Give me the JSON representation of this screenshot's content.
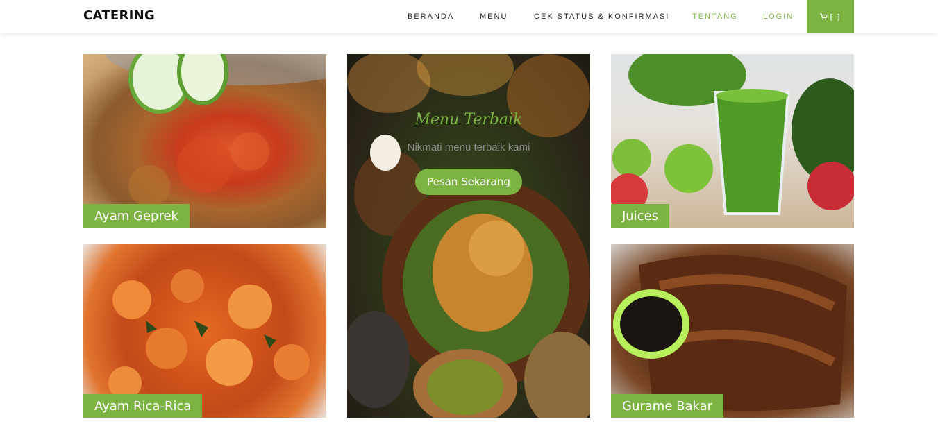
{
  "brand": "CATERING",
  "nav": {
    "items": [
      {
        "label": "BERANDA"
      },
      {
        "label": "MENU"
      },
      {
        "label": "CEK STATUS & KONFIRMASI"
      },
      {
        "label": "TENTANG"
      },
      {
        "label": "LOGIN"
      }
    ],
    "cart_label": "[ ]",
    "cart_icon": "cart-icon",
    "accent_color": "#7cb342"
  },
  "cards": [
    {
      "label": "Ayam Geprek"
    },
    {
      "label": "Juices"
    },
    {
      "label": "Ayam Rica-Rica"
    },
    {
      "label": "Gurame Bakar"
    }
  ],
  "hero": {
    "title": "Menu Terbaik",
    "subtitle": "Nikmati menu terbaik kami",
    "button": "Pesan Sekarang"
  }
}
